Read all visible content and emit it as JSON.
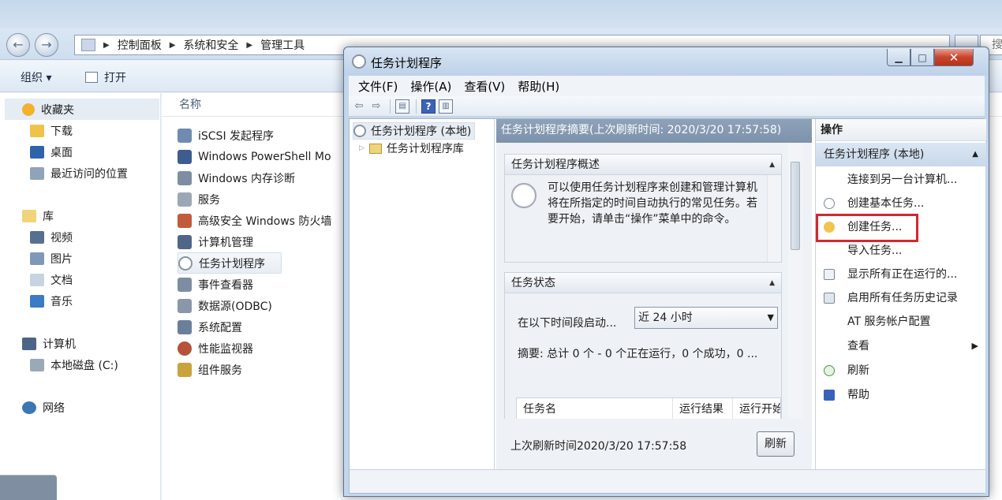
{
  "explorer": {
    "breadcrumb": [
      "控制面板",
      "系统和安全",
      "管理工具"
    ],
    "search_placeholder": "搜",
    "toolbar": {
      "organize": "组织 ▾",
      "open": "打开"
    },
    "nav": {
      "favorites": "收藏夹",
      "downloads": "下载",
      "desktop": "桌面",
      "recent": "最近访问的位置",
      "libraries": "库",
      "videos": "视频",
      "pictures": "图片",
      "documents": "文档",
      "music": "音乐",
      "computer": "计算机",
      "local_disk": "本地磁盘 (C:)",
      "network": "网络"
    },
    "list_header": "名称",
    "items": [
      "iSCSI 发起程序",
      "Windows PowerShell Mo",
      "Windows 内存诊断",
      "服务",
      "高级安全 Windows 防火墙",
      "计算机管理",
      "任务计划程序",
      "事件查看器",
      "数据源(ODBC)",
      "系统配置",
      "性能监视器",
      "组件服务"
    ]
  },
  "taskscheduler": {
    "title": "任务计划程序",
    "menu": [
      "文件(F)",
      "操作(A)",
      "查看(V)",
      "帮助(H)"
    ],
    "tree": {
      "root": "任务计划程序 (本地)",
      "library": "任务计划程序库"
    },
    "center": {
      "header": "任务计划程序摘要(上次刷新时间: 2020/3/20 17:57:58)",
      "overview_title": "任务计划程序概述",
      "overview_text": "可以使用任务计划程序来创建和管理计算机将在所指定的时间自动执行的常见任务。若要开始，请单击“操作”菜单中的命令。",
      "status_title": "任务状态",
      "period_label": "在以下时间段启动...",
      "period_value": "近 24 小时",
      "summary": "摘要: 总计 0 个 - 0 个正在运行，0 个成功，0 ...",
      "columns": [
        "任务名",
        "运行结果",
        "运行开始"
      ],
      "last_refresh": "上次刷新时间2020/3/20 17:57:58",
      "refresh_button": "刷新"
    },
    "actions": {
      "header": "操作",
      "group": "任务计划程序 (本地)",
      "items": [
        "连接到另一台计算机...",
        "创建基本任务...",
        "创建任务...",
        "导入任务...",
        "显示所有正在运行的...",
        "启用所有任务历史记录",
        "AT 服务帐户配置",
        "查看",
        "刷新",
        "帮助"
      ]
    }
  },
  "colors": {
    "highlight": "#d6262e",
    "accent": "#3a62b8"
  }
}
